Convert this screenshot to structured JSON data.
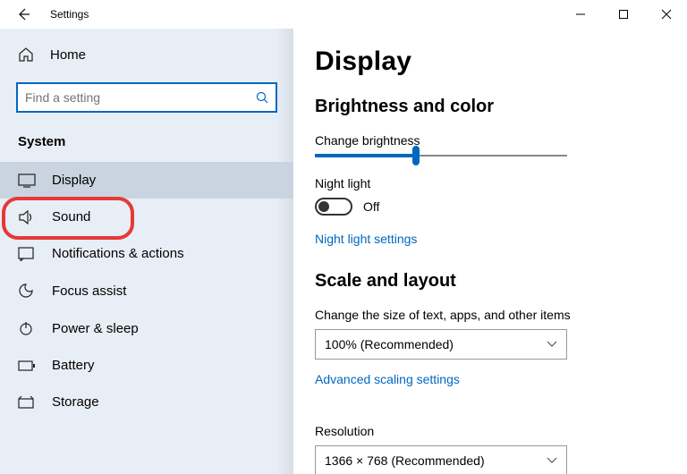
{
  "window": {
    "title": "Settings"
  },
  "sidebar": {
    "home": "Home",
    "search_placeholder": "Find a setting",
    "category": "System",
    "items": [
      {
        "label": "Display",
        "selected": true
      },
      {
        "label": "Sound"
      },
      {
        "label": "Notifications & actions"
      },
      {
        "label": "Focus assist"
      },
      {
        "label": "Power & sleep"
      },
      {
        "label": "Battery"
      },
      {
        "label": "Storage"
      }
    ]
  },
  "content": {
    "title": "Display",
    "section1": {
      "heading": "Brightness and color",
      "brightness_label": "Change brightness",
      "brightness_percent": 40,
      "night_light_label": "Night light",
      "night_light_state": "Off",
      "night_light_link": "Night light settings"
    },
    "section2": {
      "heading": "Scale and layout",
      "scale_label": "Change the size of text, apps, and other items",
      "scale_value": "100% (Recommended)",
      "scale_link": "Advanced scaling settings",
      "resolution_label": "Resolution",
      "resolution_value": "1366 × 768 (Recommended)"
    }
  }
}
